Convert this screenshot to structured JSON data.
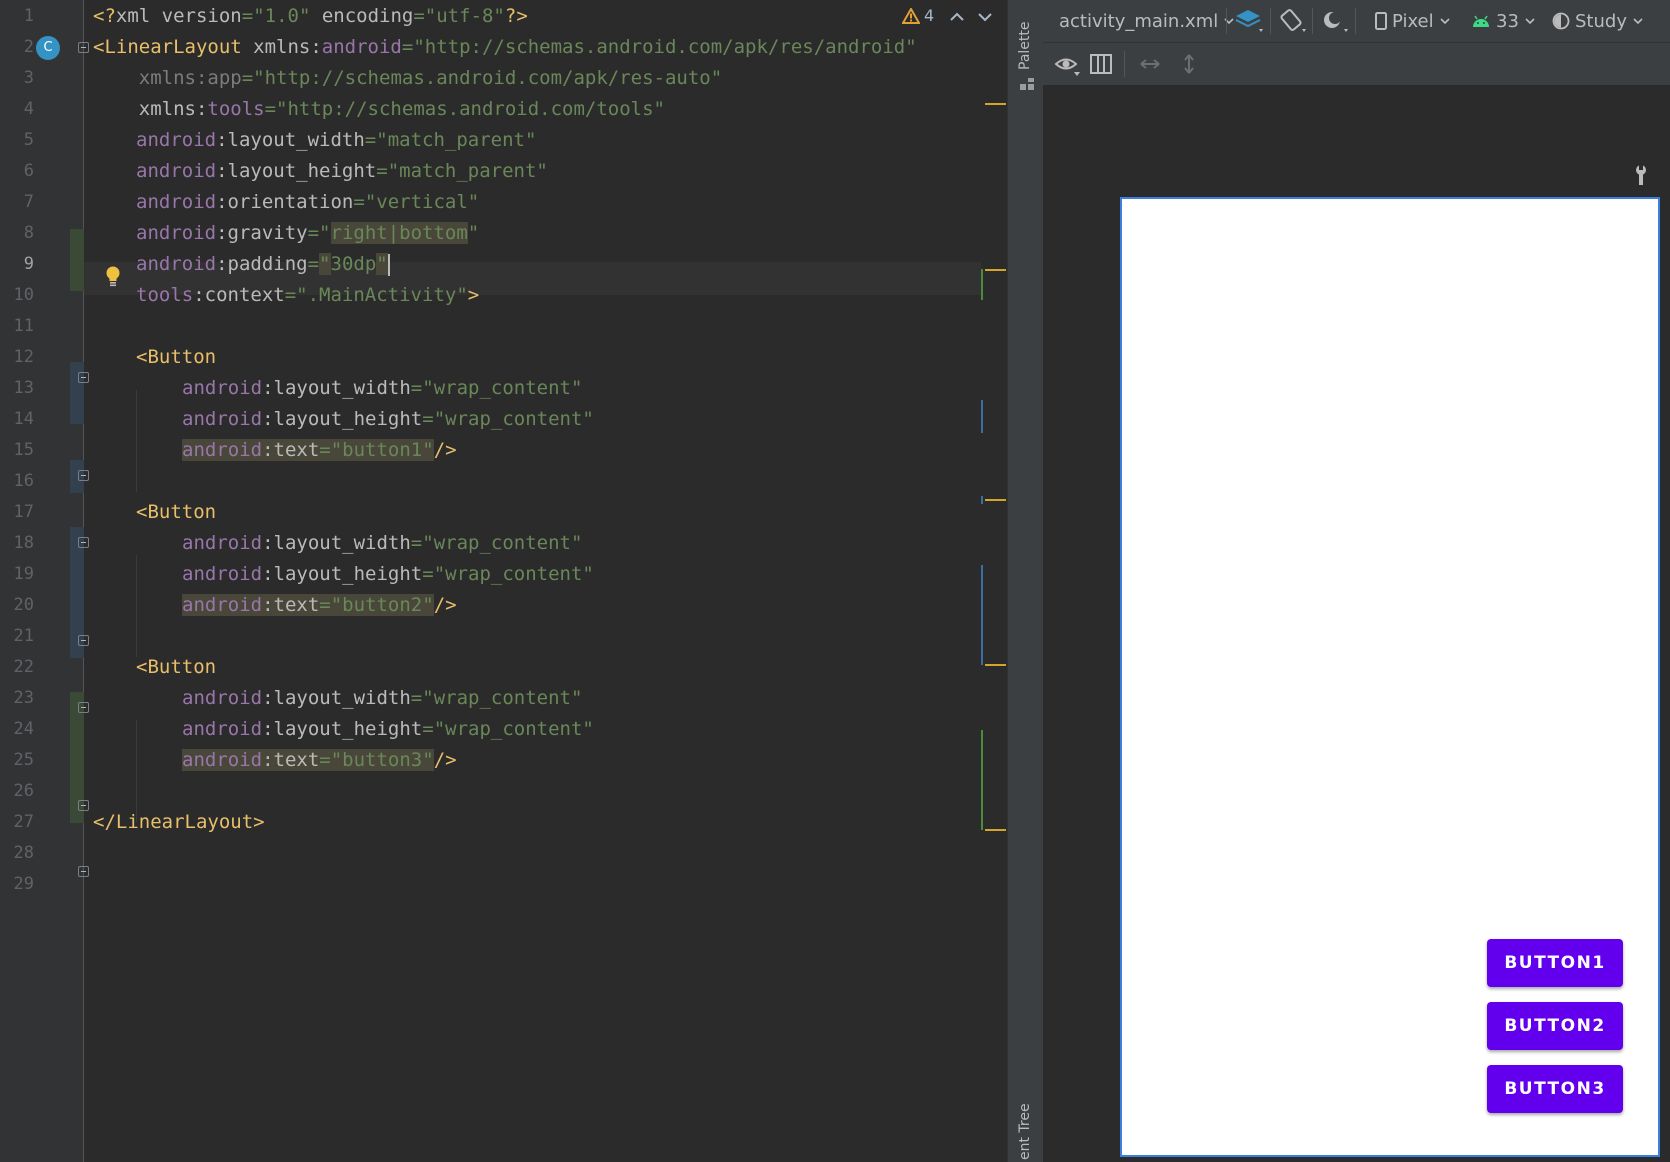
{
  "editor": {
    "warnings_count": "4",
    "line_numbers": [
      "1",
      "2",
      "3",
      "4",
      "5",
      "6",
      "7",
      "8",
      "9",
      "10",
      "11",
      "12",
      "13",
      "14",
      "15",
      "16",
      "17",
      "18",
      "19",
      "20",
      "21",
      "22",
      "23",
      "24",
      "25",
      "26",
      "27",
      "28",
      "29"
    ],
    "class_badge": "C",
    "lines": {
      "l1": {
        "t1": "<?",
        "t2": "xml version",
        "t3": "=",
        "t4": "\"1.0\"",
        "t5": " encoding",
        "t6": "=",
        "t7": "\"utf-8\"",
        "t8": "?>"
      },
      "l2": {
        "t1": "<LinearLayout",
        "t2": " xmlns:",
        "t3": "android",
        "t4": "=",
        "t5": "\"http://schemas.android.com/apk/res/android\""
      },
      "l3": {
        "t1": "    xmlns:app",
        "t2": "=",
        "t3": "\"http://schemas.android.com/apk/res-auto\""
      },
      "l4": {
        "t1": "    xmlns:",
        "t2": "tools",
        "t3": "=",
        "t4": "\"http://schemas.android.com/tools\""
      },
      "l5": {
        "t1": "android",
        "t2": ":layout_width",
        "t3": "=",
        "t4": "\"match_parent\""
      },
      "l6": {
        "t1": "android",
        "t2": ":layout_height",
        "t3": "=",
        "t4": "\"match_parent\""
      },
      "l7": {
        "t1": "android",
        "t2": ":orientation",
        "t3": "=",
        "t4": "\"vertical\""
      },
      "l8": {
        "t1": "android",
        "t2": ":gravity",
        "t3": "=",
        "t4": "\"",
        "t5": "right|bottom",
        "t6": "\""
      },
      "l9": {
        "t1": "android",
        "t2": ":padding",
        "t3": "=",
        "t4": "\"",
        "t5": "30dp",
        "t6": "\""
      },
      "l10": {
        "t1": "tools",
        "t2": ":context",
        "t3": "=",
        "t4": "\".MainActivity\"",
        "t5": ">"
      },
      "l12": {
        "t1": "<Button"
      },
      "l13": {
        "t1": "android",
        "t2": ":layout_width",
        "t3": "=",
        "t4": "\"wrap_content\""
      },
      "l14": {
        "t1": "android",
        "t2": ":layout_height",
        "t3": "=",
        "t4": "\"wrap_content\""
      },
      "l15": {
        "t1": "android",
        "t2": ":text",
        "t3": "=",
        "t4": "\"button1\"",
        "t5": "/>"
      },
      "l17": {
        "t1": "<Button"
      },
      "l18": {
        "t1": "android",
        "t2": ":layout_width",
        "t3": "=",
        "t4": "\"wrap_content\""
      },
      "l19": {
        "t1": "android",
        "t2": ":layout_height",
        "t3": "=",
        "t4": "\"wrap_content\""
      },
      "l20": {
        "t1": "android",
        "t2": ":text",
        "t3": "=",
        "t4": "\"button2\"",
        "t5": "/>"
      },
      "l22": {
        "t1": "<Button"
      },
      "l23": {
        "t1": "android",
        "t2": ":layout_width",
        "t3": "=",
        "t4": "\"wrap_content\""
      },
      "l24": {
        "t1": "android",
        "t2": ":layout_height",
        "t3": "=",
        "t4": "\"wrap_content\""
      },
      "l25": {
        "t1": "android",
        "t2": ":text",
        "t3": "=",
        "t4": "\"button3\"",
        "t5": "/>"
      },
      "l27": {
        "t1": "</LinearLayout>"
      }
    }
  },
  "sidebar": {
    "palette_label": "Palette",
    "component_tree_label": "ent Tree"
  },
  "designer_toolbar": {
    "file_name": "activity_main.xml",
    "device": "Pixel",
    "api_level": "33",
    "theme": "Study"
  },
  "preview": {
    "buttons": [
      "BUTTON1",
      "BUTTON2",
      "BUTTON3"
    ],
    "button_color": "#6200ee"
  },
  "icons": [
    "warning-icon",
    "chevron-up-icon",
    "chevron-down-icon",
    "lightbulb-icon",
    "layers-icon",
    "rotate-icon",
    "night-mode-icon",
    "phone-icon",
    "android-icon",
    "theme-icon",
    "eye-icon",
    "columns-icon",
    "horizontal-resize-icon",
    "vertical-resize-icon",
    "wrench-icon"
  ]
}
